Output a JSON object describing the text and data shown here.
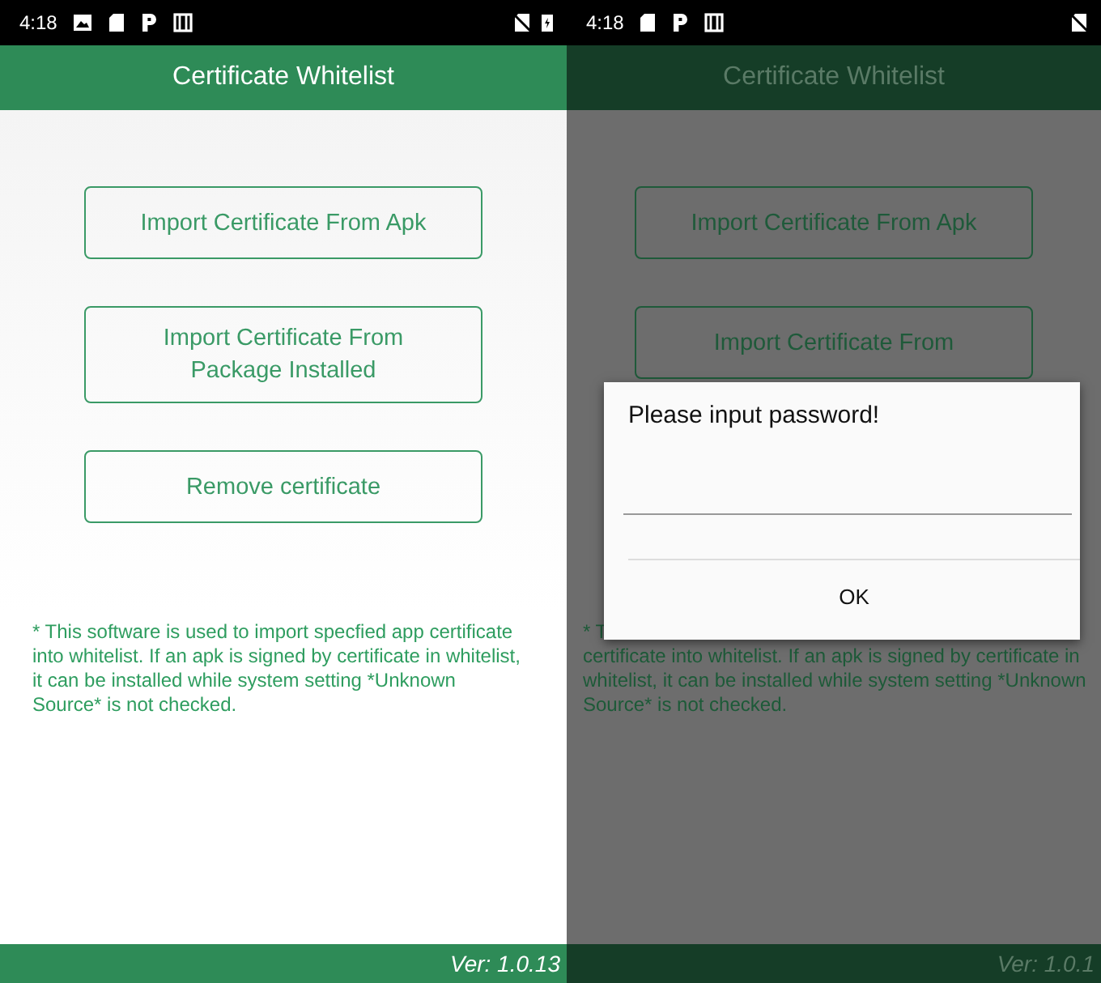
{
  "screens": [
    {
      "dimmed": false,
      "status_bar": {
        "time": "4:18"
      },
      "title": "Certificate Whitelist",
      "buttons": [
        "Import Certificate From Apk",
        "Import Certificate From\nPackage Installed",
        "Remove certificate"
      ],
      "note_parts": [
        "* This software is used to import specfied app certificate into whitelist. If an apk is signed by certificate in whitelist, it can be installed while system setting *Unknown Source* is not checked."
      ],
      "footer": "Ver: 1.0.13"
    },
    {
      "dimmed": true,
      "status_bar": {
        "time": "4:18"
      },
      "title": "Certificate Whitelist",
      "buttons": [
        "Import Certificate From Apk",
        "Import Certificate From"
      ],
      "note_parts": [
        "* T",
        "certificate into whitelist. If an apk is signed by certificate in whitelist, it can be installed while system setting *Unknown Source* is not checked."
      ],
      "footer": "Ver: 1.0.1",
      "dialog": {
        "title": "Please input password!",
        "button": "OK"
      }
    }
  ]
}
